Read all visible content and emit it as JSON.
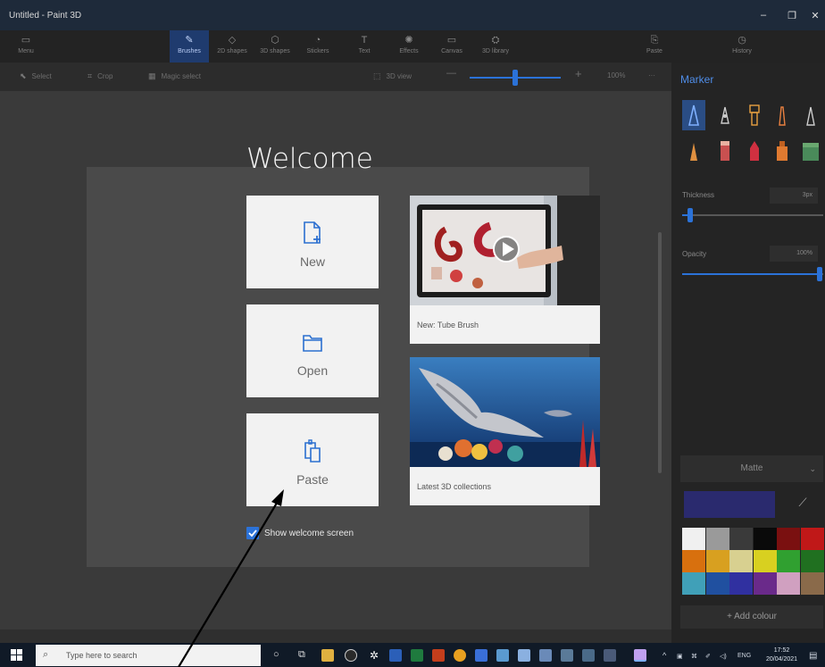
{
  "window": {
    "title": "Untitled - Paint 3D"
  },
  "ribbon": {
    "menu": "Menu",
    "tools": [
      "Brushes",
      "2D shapes",
      "3D shapes",
      "Stickers",
      "Text",
      "Effects",
      "Canvas",
      "3D library"
    ],
    "paste": "Paste",
    "history": "History"
  },
  "subbar": {
    "select": "Select",
    "crop": "Crop",
    "magic_select": "Magic select",
    "view": "3D view",
    "zoom_minus": "—",
    "zoom_plus": "+",
    "zoom_level": "100%",
    "more": "···"
  },
  "welcome": {
    "title": "Welcome",
    "new_label": "New",
    "open_label": "Open",
    "paste_label": "Paste",
    "card1_caption": "New: Tube Brush",
    "card2_caption": "Latest 3D collections",
    "show_welcome_label": "Show welcome screen",
    "show_welcome_checked": true
  },
  "panel": {
    "title": "Marker",
    "thickness_label": "Thickness",
    "thickness_value": "3px",
    "opacity_label": "Opacity",
    "opacity_value": "100%",
    "finish": "Matte",
    "add_colour": "+  Add colour",
    "current_color": "#2a2a6e",
    "swatches": [
      "#f0f0f0",
      "#9a9a9a",
      "#3a3a3a",
      "#0a0a0a",
      "#7a1010",
      "#c01818",
      "#d8700e",
      "#d8a020",
      "#d8d090",
      "#d8d020",
      "#30a030",
      "#207020",
      "#40a0b8",
      "#2050a0",
      "#3030a0",
      "#6a2a8a",
      "#d0a0c0",
      "#8a6a4a"
    ]
  },
  "taskbar": {
    "search_placeholder": "Type here to search",
    "language": "ENG",
    "time": "17:52",
    "date": "20/04/2021"
  }
}
